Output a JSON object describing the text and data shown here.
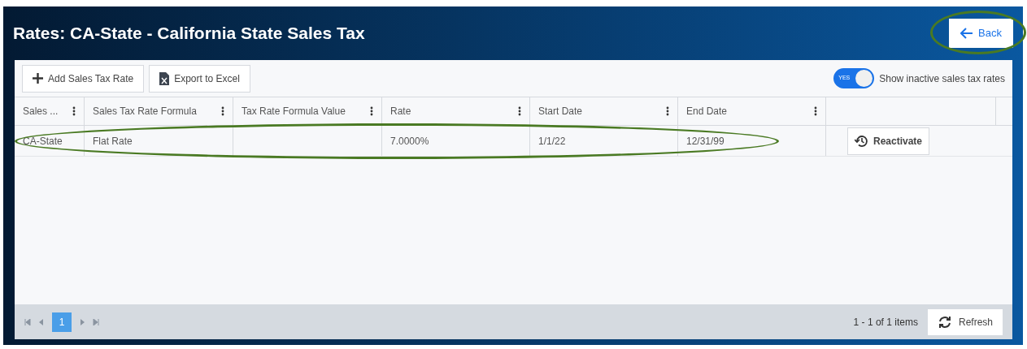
{
  "header": {
    "title": "Rates: CA-State - California State Sales Tax",
    "back_button": "Back"
  },
  "toolbar": {
    "buttons": [
      "Add Sales Tax Rate",
      "Export to Excel"
    ],
    "toggle": {
      "label": "Show inactive sales tax rates",
      "on": true,
      "on_text": "YES"
    }
  },
  "table": {
    "columns": [
      "Sales ...",
      "Sales Tax Rate Formula",
      "Tax Rate Formula Value",
      "Rate",
      "Start Date",
      "End Date"
    ],
    "rows": [
      {
        "cells": [
          "CA-State",
          "Flat Rate",
          "",
          "7.0000%",
          "1/1/22",
          "12/31/99"
        ],
        "action": "Reactivate"
      }
    ]
  },
  "pager": {
    "pages": [
      {
        "label": "1",
        "selected": true
      }
    ],
    "summary": "1 - 1 of 1 items",
    "refresh": "Refresh"
  }
}
